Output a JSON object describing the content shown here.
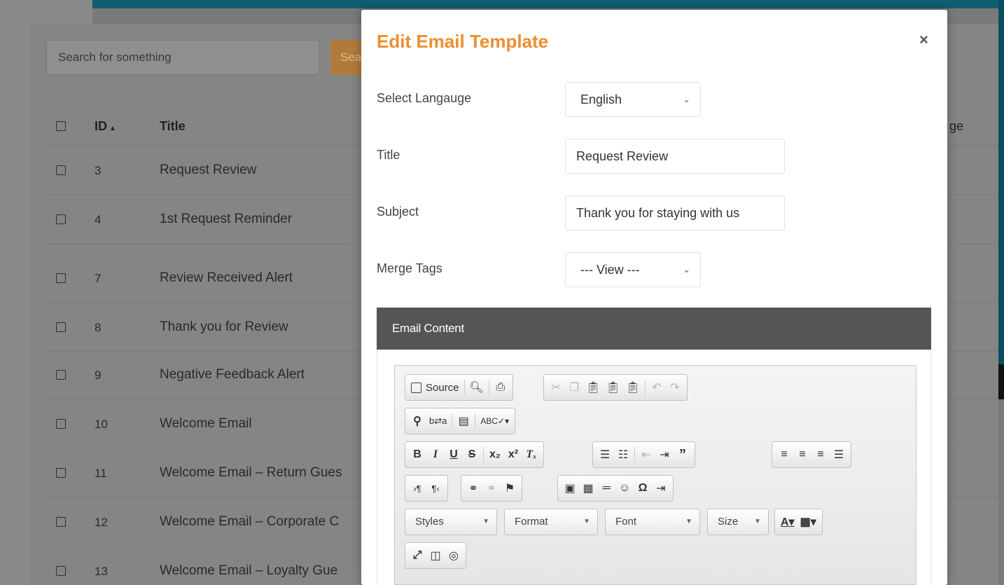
{
  "background": {
    "search": {
      "placeholder": "Search for something",
      "button_label": "Search"
    },
    "table": {
      "columns": [
        "ID",
        "Title",
        "ge"
      ],
      "sort_indicator": "▲",
      "rows": [
        {
          "id": "3",
          "title": "Request Review"
        },
        {
          "id": "4",
          "title": "1st Request Reminder"
        },
        {
          "id": "7",
          "title": "Review Received Alert"
        },
        {
          "id": "8",
          "title": "Thank you for Review"
        },
        {
          "id": "9",
          "title": "Negative Feedback Alert"
        },
        {
          "id": "10",
          "title": "Welcome Email"
        },
        {
          "id": "11",
          "title": "Welcome Email – Return Gues"
        },
        {
          "id": "12",
          "title": "Welcome Email – Corporate C"
        },
        {
          "id": "13",
          "title": "Welcome Email – Loyalty Gue"
        }
      ]
    }
  },
  "modal": {
    "title": "Edit Email Template",
    "close_label": "×",
    "fields": {
      "language": {
        "label": "Select Langauge",
        "value": "English"
      },
      "title": {
        "label": "Title",
        "value": "Request Review"
      },
      "subject": {
        "label": "Subject",
        "value": "Thank you for staying with us"
      },
      "merge_tags": {
        "label": "Merge Tags",
        "value": "--- View ---"
      }
    },
    "email_content": {
      "header": "Email Content",
      "toolbar": {
        "source_label": "Source",
        "styles_label": "Styles",
        "format_label": "Format",
        "font_label": "Font",
        "size_label": "Size"
      }
    }
  },
  "colors": {
    "accent": "#ee8d2f",
    "section_header": "#555555",
    "top_band": "#0f5f70"
  }
}
